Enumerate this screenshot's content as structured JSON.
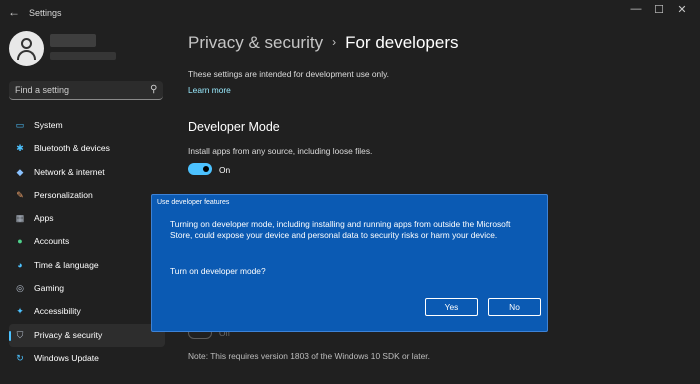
{
  "window": {
    "back_glyph": "←",
    "title": "Settings",
    "controls": [
      "—",
      "☐",
      "✕"
    ]
  },
  "search": {
    "placeholder": "Find a setting",
    "icon": "search-icon"
  },
  "sidebar": {
    "items": [
      {
        "label": "System",
        "icon": "monitor-icon",
        "glyph": "▭",
        "color": "#4cc2ff"
      },
      {
        "label": "Bluetooth & devices",
        "icon": "bluetooth-icon",
        "glyph": "✱",
        "color": "#4cc2ff"
      },
      {
        "label": "Network & internet",
        "icon": "wifi-icon",
        "glyph": "◆",
        "color": "#8ac2ff"
      },
      {
        "label": "Personalization",
        "icon": "brush-icon",
        "glyph": "✎",
        "color": "#f0a36a"
      },
      {
        "label": "Apps",
        "icon": "apps-icon",
        "glyph": "▦",
        "color": "#b9c3d1"
      },
      {
        "label": "Accounts",
        "icon": "person-icon",
        "glyph": "●",
        "color": "#4fd18b"
      },
      {
        "label": "Time & language",
        "icon": "globe-icon",
        "glyph": "◕",
        "color": "#4cc2ff"
      },
      {
        "label": "Gaming",
        "icon": "gamepad-icon",
        "glyph": "◎",
        "color": "#b9c3d1"
      },
      {
        "label": "Accessibility",
        "icon": "accessibility-icon",
        "glyph": "✦",
        "color": "#4cc2ff"
      },
      {
        "label": "Privacy & security",
        "icon": "shield-icon",
        "glyph": "⛉",
        "color": "#b9c3d1",
        "active": true
      },
      {
        "label": "Windows Update",
        "icon": "update-icon",
        "glyph": "↻",
        "color": "#4cc2ff"
      }
    ]
  },
  "breadcrumb": {
    "parent": "Privacy & security",
    "separator": "›",
    "current": "For developers"
  },
  "content": {
    "intro": "These settings are intended for development use only.",
    "learn_more": "Learn more",
    "developer_mode": {
      "title": "Developer Mode",
      "description": "Install apps from any source, including loose files.",
      "toggle_state": "On"
    },
    "partial_toggle_state": "Off",
    "note": "Note: This requires version 1803 of the Windows 10 SDK or later."
  },
  "dialog": {
    "title": "Use developer features",
    "body": "Turning on developer mode, including installing and running apps from outside the Microsoft Store, could expose your device and personal data to security risks or harm your device.",
    "question": "Turn on developer mode?",
    "yes_label": "Yes",
    "no_label": "No"
  },
  "colors": {
    "accent": "#4cc2ff",
    "dialog_bg": "#0b5ab3",
    "window_bg": "#202020"
  }
}
